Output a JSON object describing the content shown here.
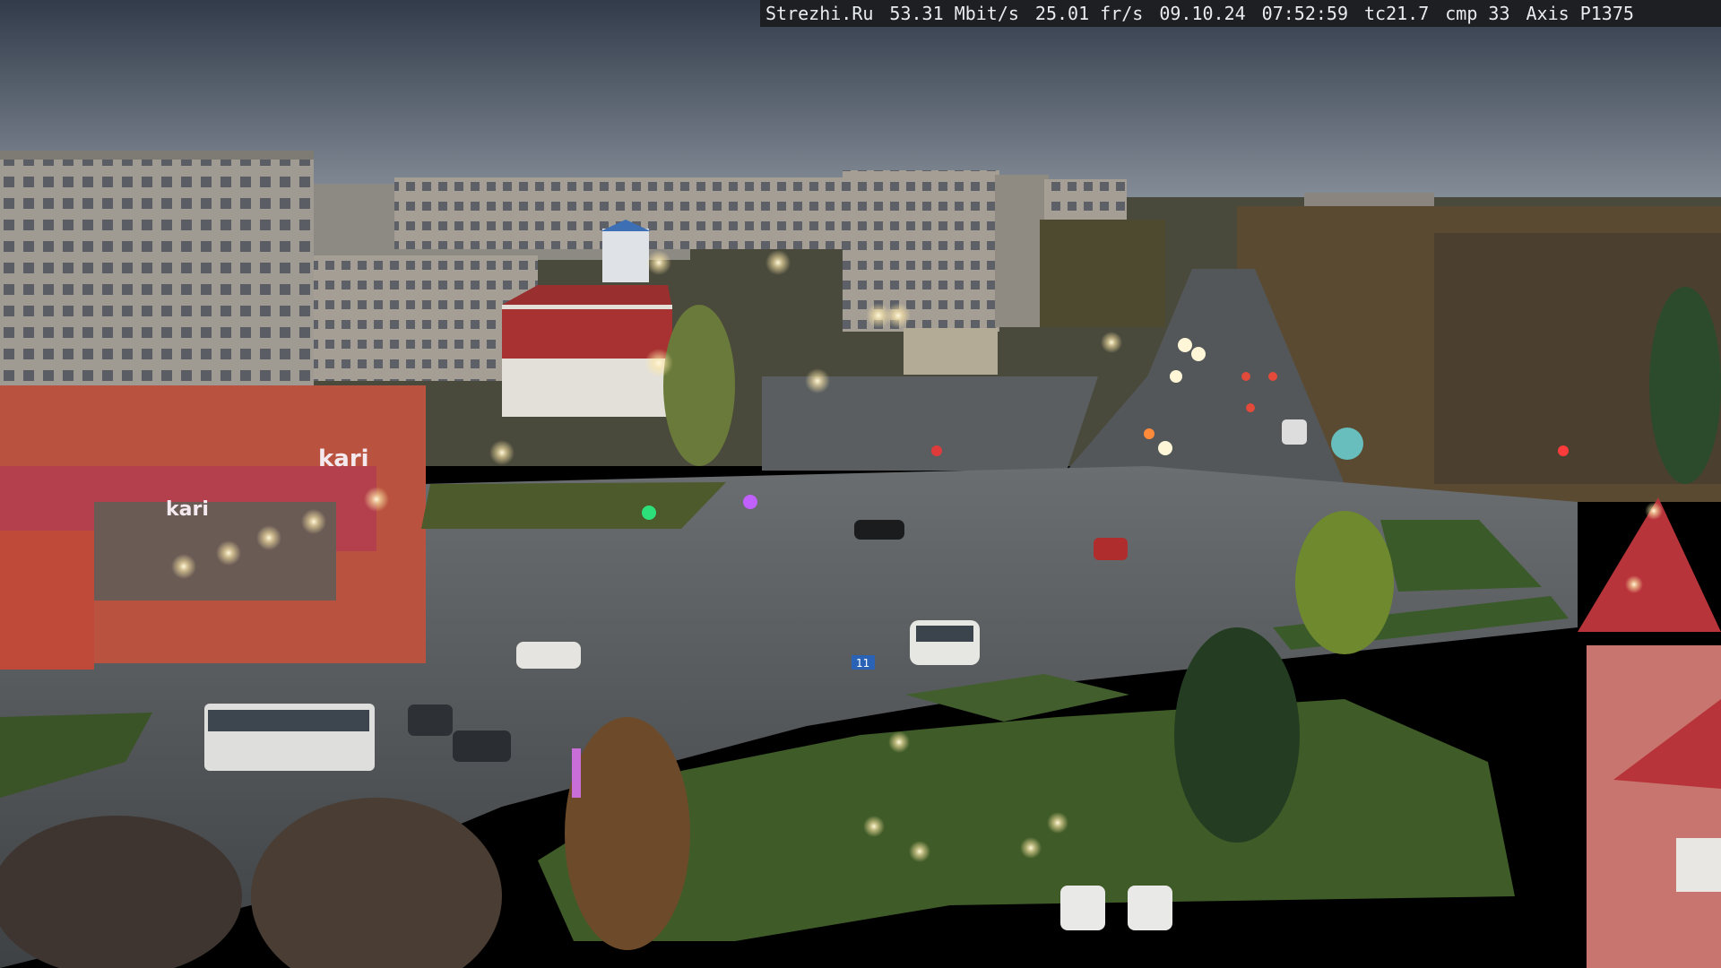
{
  "overlay": {
    "site": "Strezhi.Ru",
    "bitrate": "53.31 Mbit/s",
    "framerate": "25.01 fr/s",
    "date": "09.10.24",
    "time": "07:52:59",
    "tc": "tc21.7",
    "cmp": "cmp 33",
    "camera_model": "Axis P1375"
  },
  "signs": {
    "store_sign": "kari",
    "route_sign": "11"
  },
  "colors": {
    "sky_top": "#3b4453",
    "sky_bottom": "#7e8893",
    "road": "#4e5357",
    "grass": "#3f5a2a",
    "building": "#a8a29a",
    "brick": "#b5503e",
    "red_roof": "#c83a3a",
    "lamp": "#fff5d6"
  }
}
